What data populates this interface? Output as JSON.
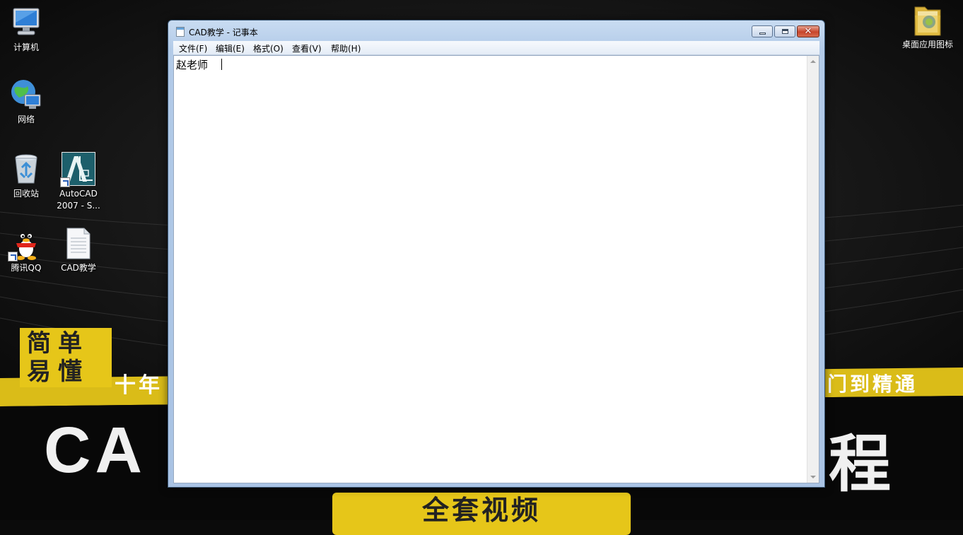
{
  "desktop": {
    "icons": [
      {
        "label": "计算机",
        "icon": "computer-icon"
      },
      {
        "label": "网络",
        "icon": "network-icon"
      },
      {
        "label": "回收站",
        "icon": "recycle-bin-icon"
      },
      {
        "label": "AutoCAD 2007 - S...",
        "icon": "autocad-icon"
      },
      {
        "label": "腾讯QQ",
        "icon": "qq-penguin-icon"
      },
      {
        "label": "CAD教学",
        "icon": "text-document-icon"
      },
      {
        "label": "桌面应用图标",
        "icon": "folder-icon"
      }
    ]
  },
  "wallpaper": {
    "badge_line1": "简单",
    "badge_line2": "易懂",
    "slogan_left": "十年",
    "slogan_right": "门到精通",
    "big_left": "CA",
    "big_right": "程",
    "bottom_pill": "全套视频",
    "colors": {
      "accent_yellow": "#e6c619",
      "background": "#0b0b0b"
    }
  },
  "window": {
    "title": "CAD教学 - 记事本",
    "menu": [
      "文件(F)",
      "编辑(E)",
      "格式(O)",
      "查看(V)",
      "帮助(H)"
    ],
    "content": "赵老师",
    "controls": {
      "minimize": "minimize-icon",
      "maximize": "maximize-icon",
      "close": "close-icon",
      "close_glyph": "✕"
    },
    "colors": {
      "frame": "#b3cbe8",
      "close_button": "#c8452b"
    }
  }
}
